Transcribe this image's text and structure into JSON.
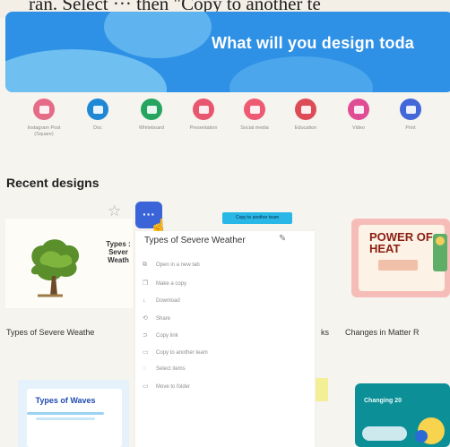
{
  "page_top_text": "ran. Select ··· then \"Copy to another te",
  "banner": {
    "title": "What will you design toda"
  },
  "categories": [
    {
      "label": "Instagram Post (Square)",
      "color": "#e56b86",
      "icon": "instagram-square-icon"
    },
    {
      "label": "Doc",
      "color": "#1e88d6",
      "icon": "doc-icon"
    },
    {
      "label": "Whiteboard",
      "color": "#25a560",
      "icon": "whiteboard-icon"
    },
    {
      "label": "Presentation",
      "color": "#e9566f",
      "icon": "presentation-icon"
    },
    {
      "label": "Social media",
      "color": "#ee5a72",
      "icon": "social-media-icon"
    },
    {
      "label": "Education",
      "color": "#dd4b57",
      "icon": "education-icon"
    },
    {
      "label": "Video",
      "color": "#e04d95",
      "icon": "video-icon"
    },
    {
      "label": "Print",
      "color": "#4267d9",
      "icon": "print-icon"
    }
  ],
  "recent": {
    "title": "Recent designs"
  },
  "thumb1": {
    "overlay_text": "Types : Sever Weath"
  },
  "more_button": {
    "label": "···"
  },
  "tooltip": {
    "text": "Copy to another team"
  },
  "menu": {
    "title": "Types of Severe Weather",
    "items": [
      {
        "label": "Open in a new tab",
        "icon": "open-new-tab-icon",
        "glyph": "⧉"
      },
      {
        "label": "Make a copy",
        "icon": "copy-icon",
        "glyph": "❐"
      },
      {
        "label": "Download",
        "icon": "download-icon",
        "glyph": "↓"
      },
      {
        "label": "Share",
        "icon": "share-icon",
        "glyph": "⟲"
      },
      {
        "label": "Copy link",
        "icon": "link-icon",
        "glyph": "⊃"
      },
      {
        "label": "Copy to another team",
        "icon": "copy-to-team-icon",
        "glyph": "▭"
      },
      {
        "label": "Select items",
        "icon": "select-icon",
        "glyph": "◌"
      },
      {
        "label": "Move to folder",
        "icon": "folder-icon",
        "glyph": "▭"
      }
    ]
  },
  "row_labels": {
    "design1": "Types of Severe Weathe",
    "design2": "ks",
    "design3": "Changes in Matter R"
  },
  "thumb_power": {
    "title": "POWER OF HEAT"
  },
  "thumb_waves": {
    "title": "Types of Waves"
  },
  "thumb_changes": {
    "title": "Changing 20"
  }
}
